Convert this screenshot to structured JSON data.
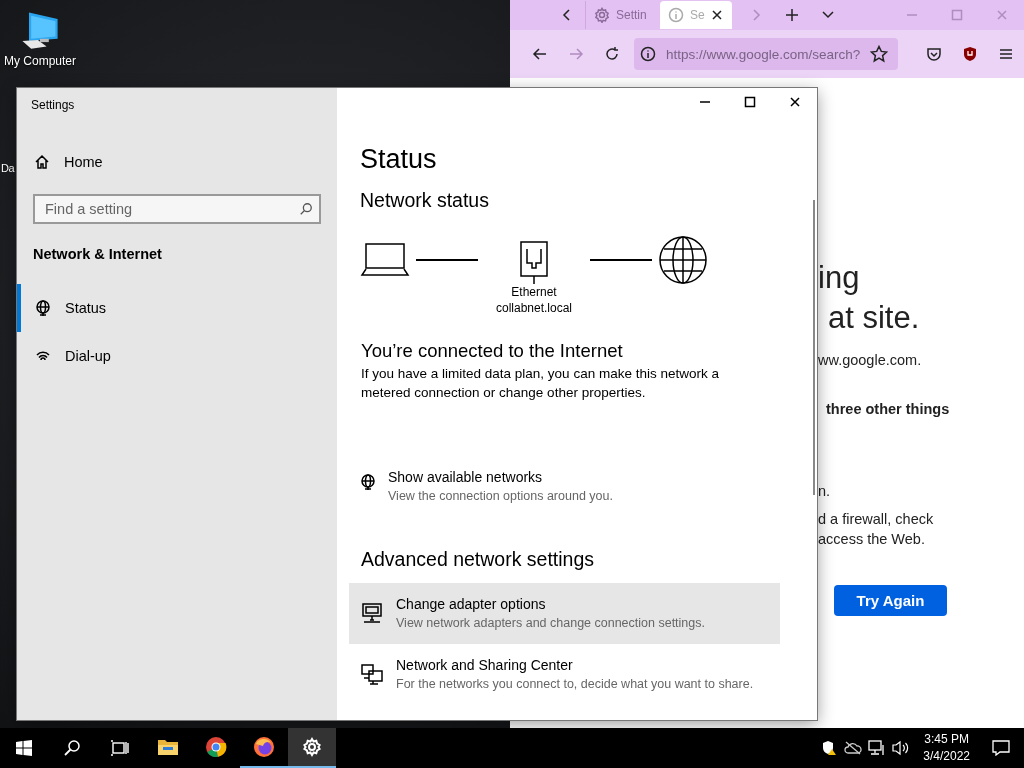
{
  "desktop_icons": [
    {
      "label": "My Computer"
    },
    {
      "label": "Da"
    }
  ],
  "browser": {
    "tabs": [
      {
        "label": "Settin",
        "selected": false
      },
      {
        "label": "Se",
        "selected": true
      }
    ],
    "url": "https://www.google.com/search?",
    "title_lines": [
      "ing",
      "at site."
    ],
    "paragraphs": [
      {
        "lines": [
          "ww.google.com."
        ],
        "bold": false
      },
      {
        "lines": [
          "three other things"
        ],
        "bold": true
      },
      {
        "lines": [
          "n."
        ],
        "bold": false
      },
      {
        "lines": [
          "d a firewall, check",
          "access the Web."
        ],
        "bold": false
      }
    ],
    "button": "Try Again"
  },
  "settings": {
    "window_title": "Settings",
    "home": "Home",
    "search": {
      "placeholder": "Find a setting"
    },
    "section": "Network & Internet",
    "nav": [
      {
        "label": "Status",
        "selected": true
      },
      {
        "label": "Dial-up",
        "selected": false
      }
    ],
    "page_title": "Status",
    "network_heading": "Network status",
    "diagram": {
      "adapter": "Ethernet",
      "network": "collabnet.local"
    },
    "connection_title": "You’re connected to the Internet",
    "connection_text": "If you have a limited data plan, you can make this network a metered connection or change other properties.",
    "links": [
      {
        "title": "Show available networks",
        "subtitle": "View the connection options around you.",
        "highlighted": false
      }
    ],
    "advanced_heading": "Advanced network settings",
    "advanced_links": [
      {
        "title": "Change adapter options",
        "subtitle": "View network adapters and change connection settings.",
        "highlighted": true
      },
      {
        "title": "Network and Sharing Center",
        "subtitle": "For the networks you connect to, decide what you want to share.",
        "highlighted": false
      }
    ]
  },
  "taskbar": {
    "apps": [
      {
        "running": false,
        "active": false
      },
      {
        "running": false,
        "active": false
      },
      {
        "running": true,
        "active": false
      },
      {
        "running": true,
        "active": true
      }
    ],
    "time": "3:45 PM",
    "date": "3/4/2022"
  }
}
